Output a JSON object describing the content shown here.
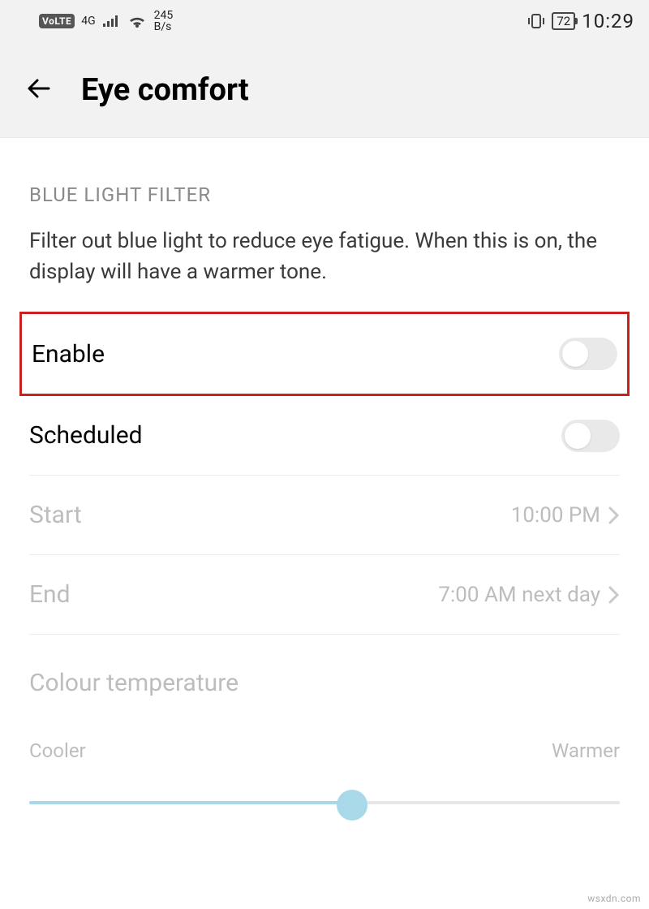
{
  "status": {
    "volte": "VoLTE",
    "net4g": "4G",
    "rateTop": "245",
    "rateBottom": "B/s",
    "battery": "72",
    "time": "10:29"
  },
  "header": {
    "title": "Eye comfort"
  },
  "section": {
    "title": "BLUE LIGHT FILTER",
    "desc": "Filter out blue light to reduce eye fatigue. When this is on, the display will have a warmer tone."
  },
  "rows": {
    "enable": "Enable",
    "scheduled": "Scheduled",
    "start": "Start",
    "startValue": "10:00 PM",
    "end": "End",
    "endValue": "7:00 AM next day"
  },
  "temp": {
    "title": "Colour temperature",
    "cooler": "Cooler",
    "warmer": "Warmer"
  },
  "watermark": "wsxdn.com"
}
